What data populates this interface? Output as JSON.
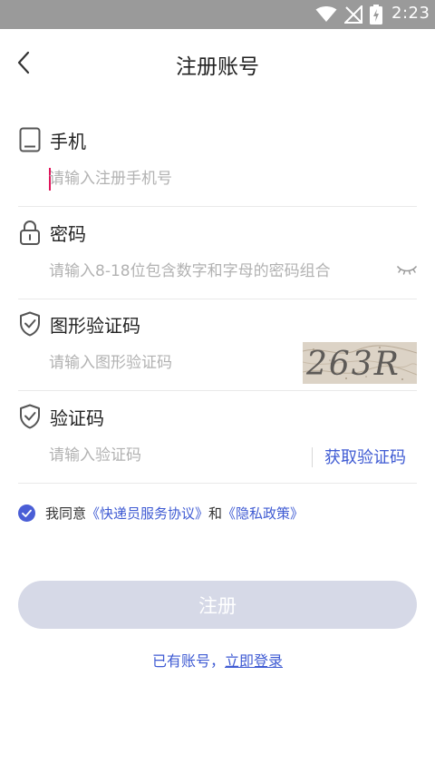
{
  "status_bar": {
    "time": "2:23",
    "icons": [
      "wifi-icon",
      "no-signal-icon",
      "battery-charging-icon"
    ]
  },
  "header": {
    "title": "注册账号",
    "back_icon": "chevron-left-icon"
  },
  "fields": {
    "phone": {
      "label": "手机",
      "placeholder": "请输入注册手机号",
      "value": "",
      "icon": "tablet-icon"
    },
    "password": {
      "label": "密码",
      "placeholder": "请输入8-18位包含数字和字母的密码组合",
      "value": "",
      "icon": "lock-icon",
      "toggle_icon": "eye-closed-icon"
    },
    "captcha": {
      "label": "图形验证码",
      "placeholder": "请输入图形验证码",
      "value": "",
      "icon": "shield-check-icon",
      "captcha_text": "263R"
    },
    "sms_code": {
      "label": "验证码",
      "placeholder": "请输入验证码",
      "value": "",
      "icon": "shield-check-icon",
      "get_code_label": "获取验证码"
    }
  },
  "agreement": {
    "checked": true,
    "prefix": "我同意",
    "service_link": "《快递员服务协议》",
    "and": "和",
    "privacy_link": "《隐私政策》"
  },
  "register_button": {
    "label": "注册",
    "enabled": false
  },
  "login_prompt": {
    "text": "已有账号，",
    "link": "立即登录"
  },
  "colors": {
    "status_bar": "#9a9a9a",
    "accent": "#3f5bd3",
    "cursor": "#e0155b",
    "button_disabled": "#d6d9e7",
    "placeholder": "#b2b2b2",
    "divider": "#e9e9e9"
  }
}
